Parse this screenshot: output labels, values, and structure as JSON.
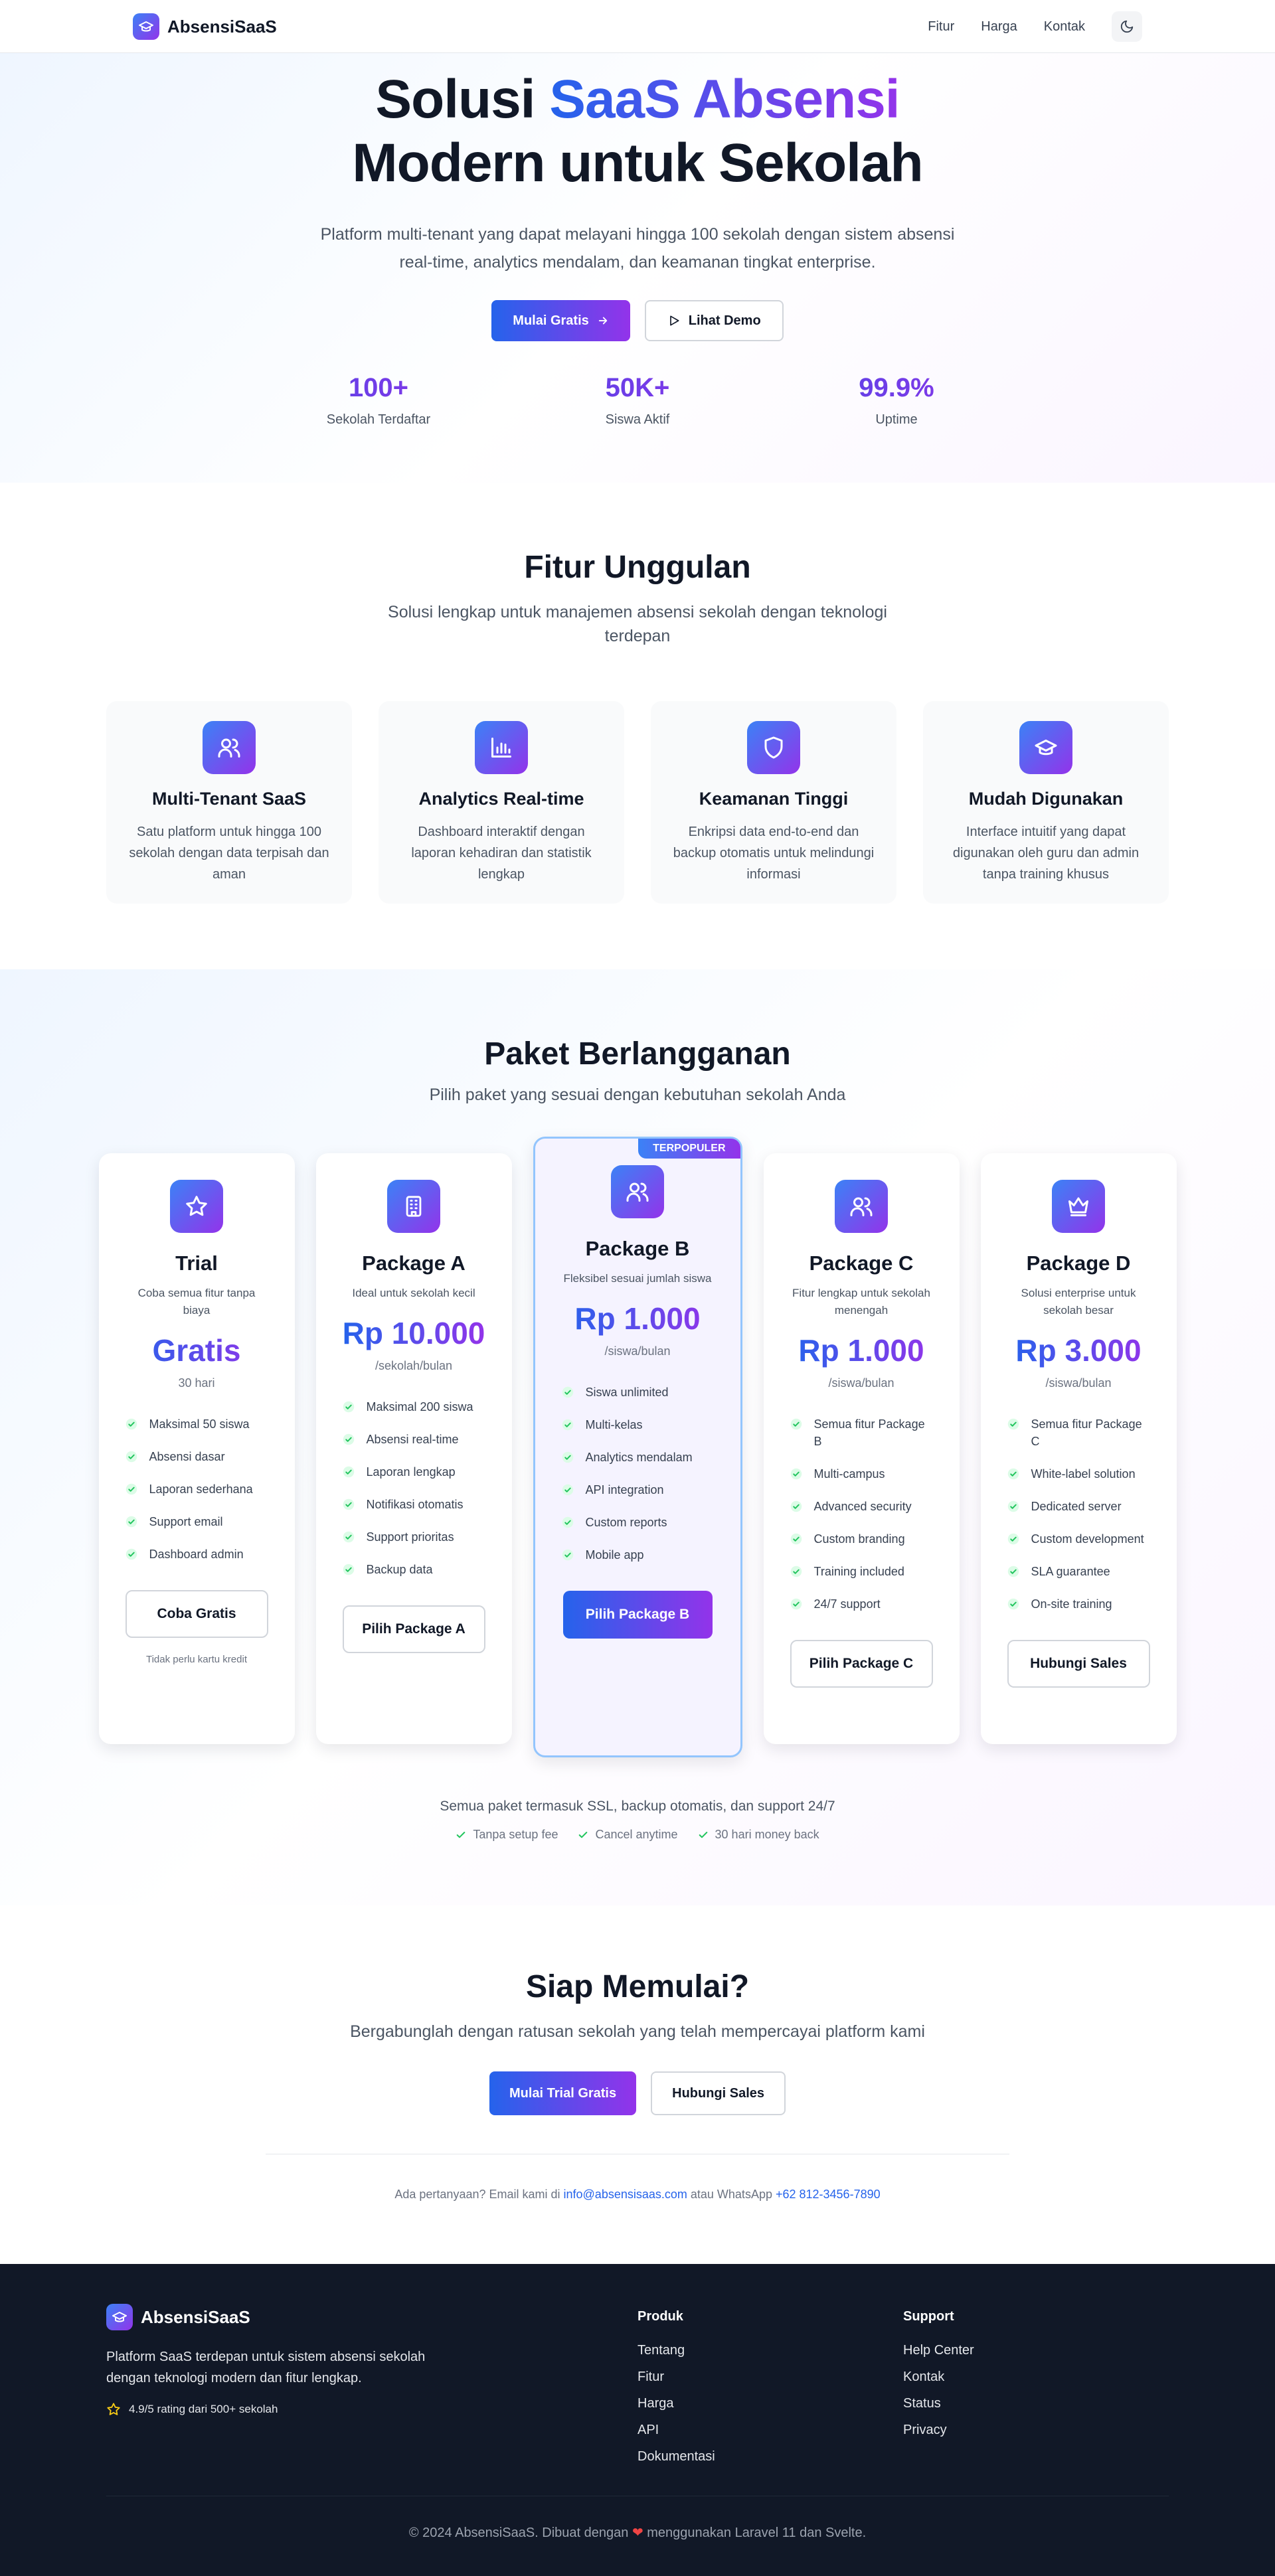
{
  "nav": {
    "brand": "AbsensiSaaS",
    "links": [
      "Fitur",
      "Harga",
      "Kontak"
    ]
  },
  "hero": {
    "title_line1_plain": "Solusi ",
    "title_line1_accent": "SaaS Absensi",
    "title_line2": "Modern untuk Sekolah",
    "subtitle": "Platform multi-tenant yang dapat melayani hingga 100 sekolah dengan sistem absensi real-time, analytics mendalam, dan keamanan tingkat enterprise.",
    "primary_cta": "Mulai Gratis",
    "secondary_cta": "Lihat Demo",
    "stats": [
      {
        "value": "100+",
        "label": "Sekolah Terdaftar"
      },
      {
        "value": "50K+",
        "label": "Siswa Aktif"
      },
      {
        "value": "99.9%",
        "label": "Uptime"
      }
    ]
  },
  "features": {
    "title": "Fitur Unggulan",
    "subtitle": "Solusi lengkap untuk manajemen absensi sekolah dengan teknologi terdepan",
    "items": [
      {
        "icon": "users-icon",
        "title": "Multi-Tenant SaaS",
        "desc": "Satu platform untuk hingga 100 sekolah dengan data terpisah dan aman"
      },
      {
        "icon": "chart-icon",
        "title": "Analytics Real-time",
        "desc": "Dashboard interaktif dengan laporan kehadiran dan statistik lengkap"
      },
      {
        "icon": "shield-icon",
        "title": "Keamanan Tinggi",
        "desc": "Enkripsi data end-to-end dan backup otomatis untuk melindungi informasi"
      },
      {
        "icon": "graduation-cap-icon",
        "title": "Mudah Digunakan",
        "desc": "Interface intuitif yang dapat digunakan oleh guru dan admin tanpa training khusus"
      }
    ]
  },
  "pricing": {
    "title": "Paket Berlangganan",
    "subtitle": "Pilih paket yang sesuai dengan kebutuhan sekolah Anda",
    "popular_badge": "TERPOPULER",
    "plans": [
      {
        "icon": "star-icon",
        "name": "Trial",
        "desc": "Coba semua fitur tanpa biaya",
        "price": "Gratis",
        "unit": "30 hari",
        "features": [
          "Maksimal 50 siswa",
          "Absensi dasar",
          "Laporan sederhana",
          "Support email",
          "Dashboard admin"
        ],
        "cta": "Coba Gratis",
        "note": "Tidak perlu kartu kredit"
      },
      {
        "icon": "building-icon",
        "name": "Package A",
        "desc": "Ideal untuk sekolah kecil",
        "price": "Rp 10.000",
        "unit": "/sekolah/bulan",
        "features": [
          "Maksimal 200 siswa",
          "Absensi real-time",
          "Laporan lengkap",
          "Notifikasi otomatis",
          "Support prioritas",
          "Backup data"
        ],
        "cta": "Pilih Package A"
      },
      {
        "icon": "users-icon",
        "name": "Package B",
        "desc": "Fleksibel sesuai jumlah siswa",
        "price": "Rp 1.000",
        "unit": "/siswa/bulan",
        "features": [
          "Siswa unlimited",
          "Multi-kelas",
          "Analytics mendalam",
          "API integration",
          "Custom reports",
          "Mobile app"
        ],
        "cta": "Pilih Package B"
      },
      {
        "icon": "users-icon",
        "name": "Package C",
        "desc": "Fitur lengkap untuk sekolah menengah",
        "price": "Rp 1.000",
        "unit": "/siswa/bulan",
        "features": [
          "Semua fitur Package B",
          "Multi-campus",
          "Advanced security",
          "Custom branding",
          "Training included",
          "24/7 support"
        ],
        "cta": "Pilih Package C"
      },
      {
        "icon": "crown-icon",
        "name": "Package D",
        "desc": "Solusi enterprise untuk sekolah besar",
        "price": "Rp 3.000",
        "unit": "/siswa/bulan",
        "features": [
          "Semua fitur Package C",
          "White-label solution",
          "Dedicated server",
          "Custom development",
          "SLA guarantee",
          "On-site training"
        ],
        "cta": "Hubungi Sales"
      }
    ],
    "footnote": "Semua paket termasuk SSL, backup otomatis, dan support 24/7",
    "guarantees": [
      "Tanpa setup fee",
      "Cancel anytime",
      "30 hari money back"
    ]
  },
  "cta": {
    "title": "Siap Memulai?",
    "subtitle": "Bergabunglah dengan ratusan sekolah yang telah mempercayai platform kami",
    "primary": "Mulai Trial Gratis",
    "secondary": "Hubungi Sales",
    "contact_prefix": "Ada pertanyaan? Email kami di ",
    "email": "info@absensisaas.com",
    "contact_mid": " atau WhatsApp ",
    "whatsapp": "+62 812-3456-7890"
  },
  "footer": {
    "brand": "AbsensiSaaS",
    "desc": "Platform SaaS terdepan untuk sistem absensi sekolah dengan teknologi modern dan fitur lengkap.",
    "rating": "4.9/5 rating dari 500+ sekolah",
    "produk_title": "Produk",
    "produk": [
      "Tentang",
      "Fitur",
      "Harga",
      "API",
      "Dokumentasi"
    ],
    "support_title": "Support",
    "support": [
      "Help Center",
      "Kontak",
      "Status",
      "Privacy"
    ],
    "copy_prefix": "© 2024 AbsensiSaaS. Dibuat dengan ",
    "copy_heart": "❤",
    "copy_suffix": " menggunakan Laravel 11 dan Svelte."
  },
  "colors": {
    "accent_blue": "#2563eb",
    "accent_purple": "#9333ea",
    "footer_bg": "#111827",
    "check_green": "#22c55e"
  }
}
